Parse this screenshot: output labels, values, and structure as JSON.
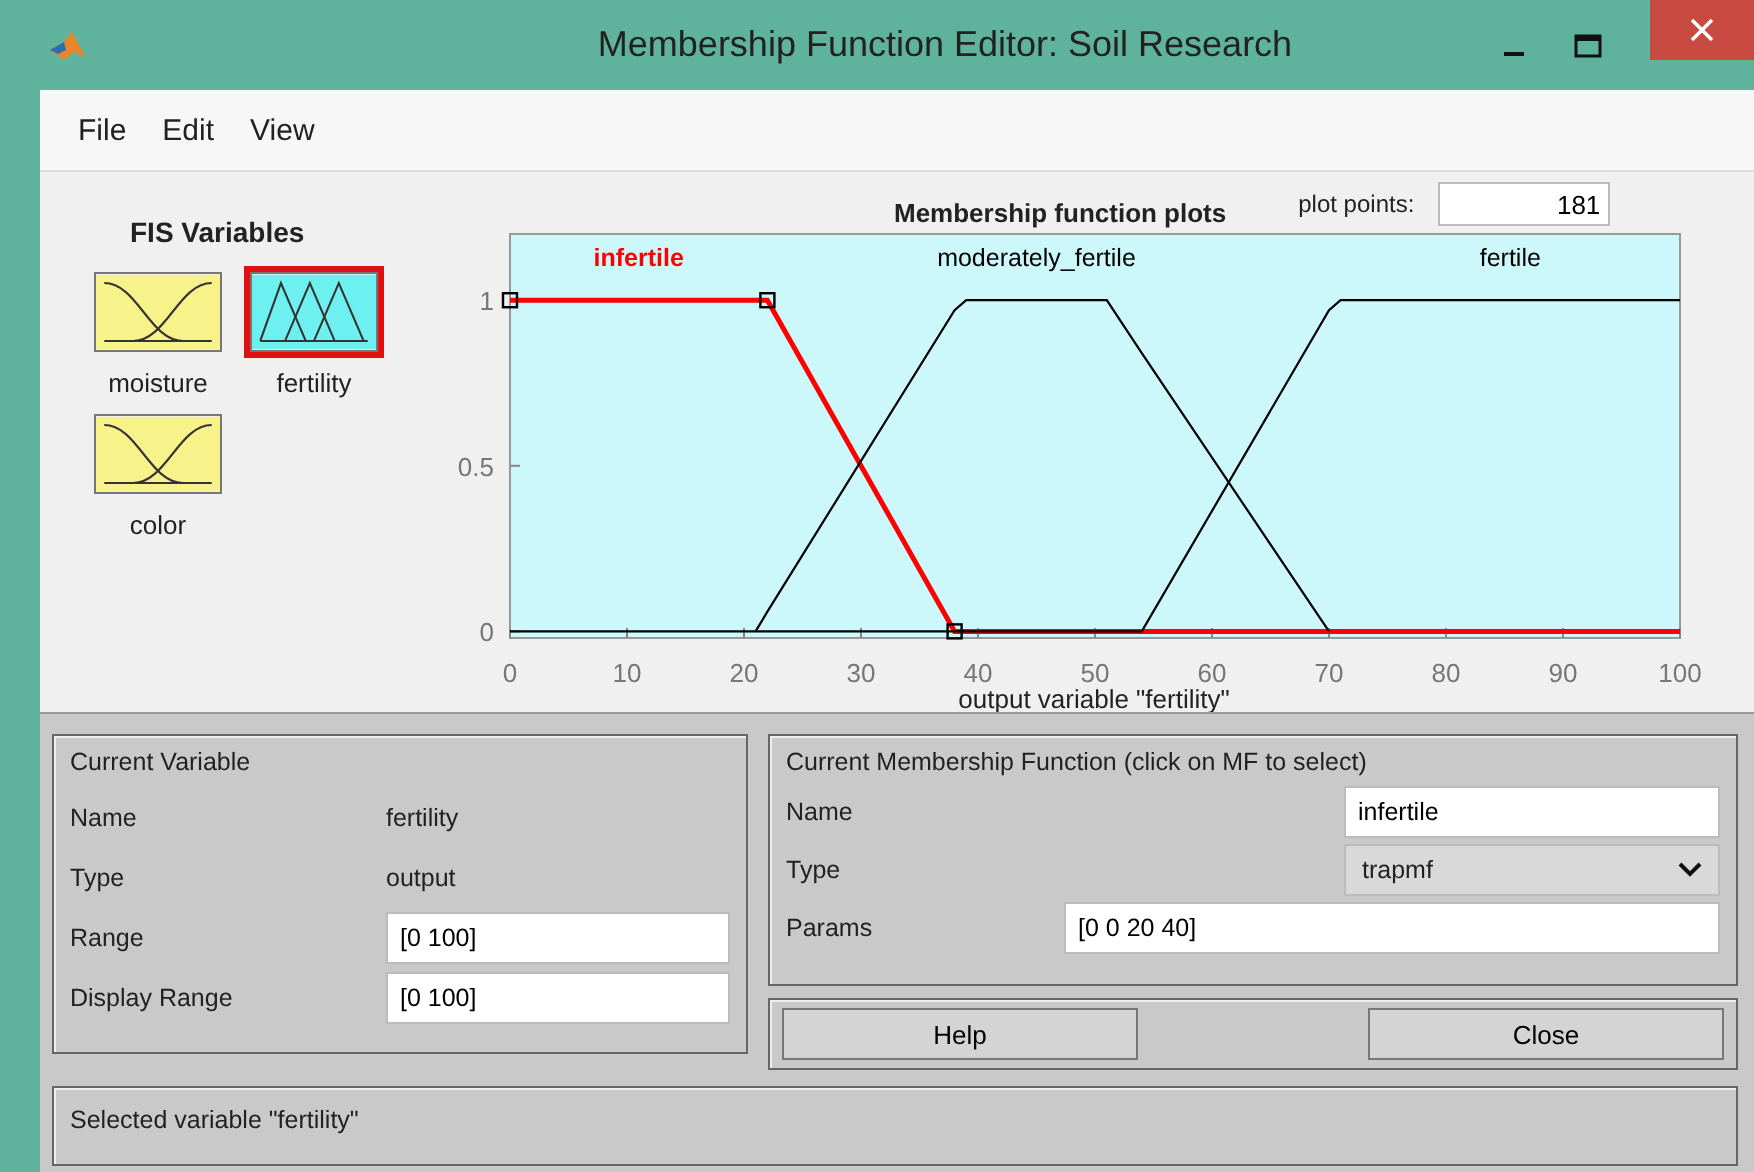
{
  "window": {
    "title": "Membership Function Editor: Soil Research"
  },
  "menu": [
    "File",
    "Edit",
    "View"
  ],
  "fis_variables": {
    "title": "FIS Variables",
    "items": [
      {
        "name": "moisture",
        "kind": "input",
        "selected": false
      },
      {
        "name": "fertility",
        "kind": "output",
        "selected": true
      },
      {
        "name": "color",
        "kind": "input",
        "selected": false
      }
    ]
  },
  "plot": {
    "plot_points_label": "plot points:",
    "plot_points": "181",
    "chart_data": {
      "type": "line",
      "title": "Membership function plots",
      "xlabel": "output variable \"fertility\"",
      "x": [
        0,
        21,
        22,
        38,
        39,
        51,
        54,
        70,
        71,
        100
      ],
      "xlim": [
        0,
        100
      ],
      "ylim": [
        -0.02,
        1.2
      ],
      "xticks": [
        0,
        10,
        20,
        30,
        40,
        50,
        60,
        70,
        80,
        90,
        100
      ],
      "yticks": [
        0,
        0.5,
        1
      ],
      "series": [
        {
          "name": "infertile",
          "color": "#ff0000",
          "values": [
            1,
            1,
            1,
            0,
            0,
            0,
            0,
            0,
            0,
            0
          ]
        },
        {
          "name": "moderately_fertile",
          "color": "#000000",
          "values": [
            null,
            0,
            0.06,
            0.97,
            1,
            1,
            0.84,
            0,
            null,
            null
          ]
        },
        {
          "name": "fertile",
          "color": "#000000",
          "values": [
            0,
            0,
            0,
            0,
            0,
            0,
            0,
            0.97,
            1,
            1
          ]
        }
      ]
    }
  },
  "current_variable": {
    "title": "Current Variable",
    "rows": [
      {
        "label": "Name",
        "value": "fertility",
        "kind": "text"
      },
      {
        "label": "Type",
        "value": "output",
        "kind": "text"
      },
      {
        "label": "Range",
        "value": "[0 100]",
        "kind": "field"
      },
      {
        "label": "Display Range",
        "value": "[0 100]",
        "kind": "field"
      }
    ]
  },
  "current_mf": {
    "title": "Current Membership Function (click on MF to select)",
    "name_label": "Name",
    "name": "infertile",
    "type_label": "Type",
    "type": "trapmf",
    "params_label": "Params",
    "params": "[0 0 20 40]"
  },
  "buttons": [
    "Help",
    "Close"
  ],
  "status": "Selected variable \"fertility\""
}
